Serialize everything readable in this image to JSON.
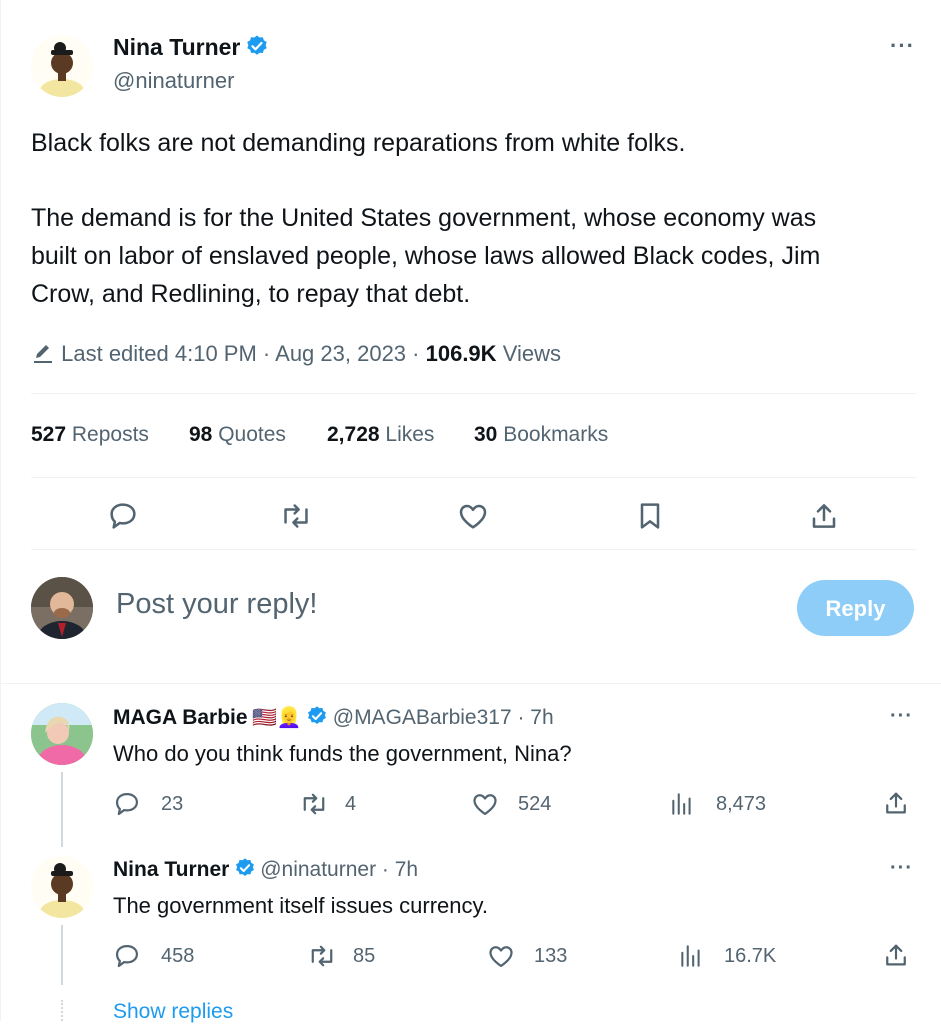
{
  "main_tweet": {
    "author_name": "Nina Turner",
    "author_handle": "@ninaturner",
    "text_p1": "Black folks are not demanding reparations from white folks.",
    "text_p2_l1": "The demand is for the United States government, whose economy was",
    "text_p2_l2": "built on labor of enslaved people, whose laws allowed Black codes, Jim",
    "text_p2_l3": "Crow, and Redlining, to repay that debt.",
    "edited_label": "Last edited 4:10 PM · Aug 23, 2023 ·",
    "views_value": "106.9K",
    "views_label": "Views",
    "reposts_value": "527",
    "reposts_label": "Reposts",
    "quotes_value": "98",
    "quotes_label": "Quotes",
    "likes_value": "2,728",
    "likes_label": "Likes",
    "bookmarks_value": "30",
    "bookmarks_label": "Bookmarks"
  },
  "composer": {
    "placeholder": "Post your reply!",
    "reply_button": "Reply"
  },
  "replies": [
    {
      "author_name": "MAGA Barbie",
      "emoji": "🇺🇸👱‍♀️",
      "handle_time": "@MAGABarbie317 · 7h",
      "text": "Who do you think funds the government, Nina?",
      "replies": "23",
      "reposts": "4",
      "likes": "524",
      "views": "8,473"
    },
    {
      "author_name": "Nina Turner",
      "handle_time": "@ninaturner · 7h",
      "text": "The government itself issues currency.",
      "replies": "458",
      "reposts": "85",
      "likes": "133",
      "views": "16.7K"
    }
  ],
  "show_replies": "Show replies",
  "colors": {
    "accent": "#1d9bf0",
    "muted": "#536471",
    "reply_button_disabled": "#8ecdf8"
  },
  "icons": [
    "verified-badge-icon",
    "pencil-icon",
    "reply-icon",
    "repost-icon",
    "like-icon",
    "bookmark-icon",
    "share-icon",
    "views-icon",
    "more-icon"
  ]
}
